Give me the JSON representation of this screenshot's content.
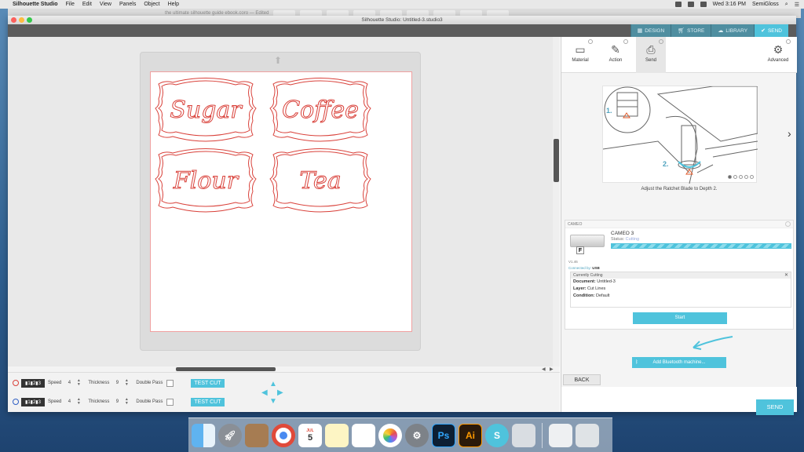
{
  "menubar": {
    "app_name": "Silhouette Studio",
    "items": [
      "File",
      "Edit",
      "View",
      "Panels",
      "Object",
      "Help"
    ],
    "clock": "Wed 3:16 PM",
    "user": "SemiGloss"
  },
  "background_tab_title": "the ultimate silhouette guide ebook.coro — Edited",
  "window": {
    "title": "Silhouette Studio: Untitled-3.studio3"
  },
  "nav_tabs": [
    {
      "label": "DESIGN",
      "icon": "grid-icon",
      "active": false
    },
    {
      "label": "STORE",
      "icon": "cart-icon",
      "active": false
    },
    {
      "label": "LIBRARY",
      "icon": "cloud-icon",
      "active": false
    },
    {
      "label": "SEND",
      "icon": "check-icon",
      "active": true
    }
  ],
  "design_labels": [
    "Sugar",
    "Coffee",
    "Flour",
    "Tea"
  ],
  "cut_settings": [
    {
      "color": "#d9413a",
      "speed_label": "Speed",
      "speed": "4",
      "thickness_label": "Thickness",
      "thickness": "9",
      "double_pass_label": "Double Pass",
      "test_cut_label": "TEST CUT"
    },
    {
      "color": "#2f5fc4",
      "speed_label": "Speed",
      "speed": "4",
      "thickness_label": "Thickness",
      "thickness": "9",
      "double_pass_label": "Double Pass",
      "test_cut_label": "TEST CUT"
    }
  ],
  "panel": {
    "tabs": [
      {
        "label": "Material",
        "icon": "material-icon"
      },
      {
        "label": "Action",
        "icon": "action-icon"
      },
      {
        "label": "Send",
        "icon": "send-icon"
      },
      {
        "label": "Advanced",
        "icon": "gear-icon"
      }
    ],
    "illustration_steps": [
      "1.",
      "2."
    ],
    "caption": "Adjust the Ratchet Blade to Depth 2.",
    "carousel": {
      "count": 5,
      "active": 0
    },
    "device": {
      "section_label": "CAMEO",
      "name": "CAMEO 3",
      "status_label": "Status:",
      "status": "Cutting",
      "blade_letter": "F",
      "firmware": "V1.46",
      "connected_label": "Connected by:",
      "connected_value": "USB",
      "progress": 1.0
    },
    "currently_cutting": {
      "title": "Currently Cutting",
      "document_label": "Document:",
      "document": "Untitled-3",
      "layer_label": "Layer:",
      "layer": "Cut Lines",
      "condition_label": "Condition:",
      "condition": "Default"
    },
    "start_label": "Start",
    "bluetooth_label": "Add Bluetooth machine...",
    "back_label": "BACK",
    "send_label": "SEND"
  },
  "dock": {
    "apps": [
      "finder-icon",
      "launchpad-icon",
      "contacts-icon",
      "chrome-icon",
      "calendar-icon",
      "notes-icon",
      "reminders-icon",
      "photos-icon",
      "system-preferences-icon",
      "photoshop-icon",
      "illustrator-icon",
      "silhouette-icon",
      "preview-icon",
      "document-icon",
      "trash-icon"
    ],
    "calendar_day": "5",
    "calendar_month": "JUL",
    "ps_text": "Ps",
    "ai_text": "Ai"
  },
  "colors": {
    "accent": "#4fc3dc",
    "cut_line": "#d9413a",
    "toolbar": "#5c5c5c"
  }
}
